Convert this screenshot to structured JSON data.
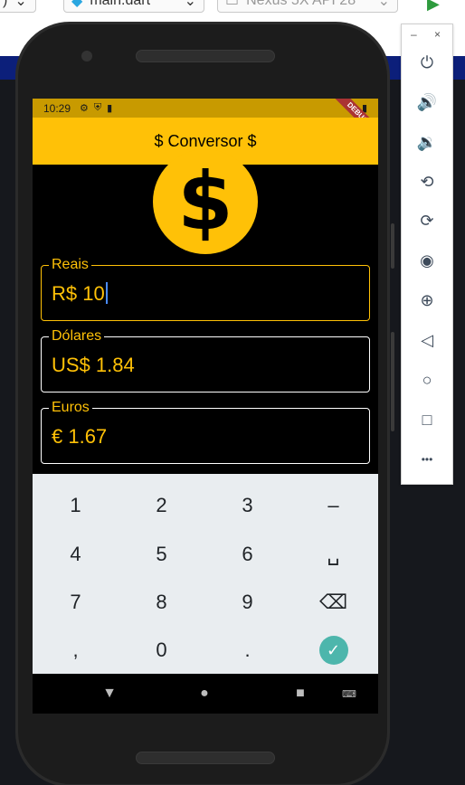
{
  "ide": {
    "left_fragment": ")",
    "file_tab": "main.dart",
    "device_tab": "Nexus 5X API 28"
  },
  "status_bar": {
    "time": "10:29",
    "debug_banner": "DEBUG"
  },
  "app_bar": {
    "title": "$ Conversor $"
  },
  "coin_icon": {
    "glyph": "$"
  },
  "fields": [
    {
      "label": "Reais",
      "value": "R$ 10"
    },
    {
      "label": "Dólares",
      "value": "US$ 1.84"
    },
    {
      "label": "Euros",
      "value": "€ 1.67"
    }
  ],
  "keyboard": {
    "row1": [
      "1",
      "2",
      "3",
      "–"
    ],
    "row2": [
      "4",
      "5",
      "6",
      "␣"
    ],
    "row3": [
      "7",
      "8",
      "9",
      "⌫"
    ],
    "row4": [
      ",",
      "0",
      ".",
      "✓"
    ]
  },
  "emulator_panel": {
    "minimize": "–",
    "close": "×",
    "more": "•••"
  },
  "colors": {
    "accent": "#ffc107",
    "status_bar": "#c89a00",
    "confirm_key": "#4db6ac",
    "keyboard_bg": "#e9edf0"
  }
}
